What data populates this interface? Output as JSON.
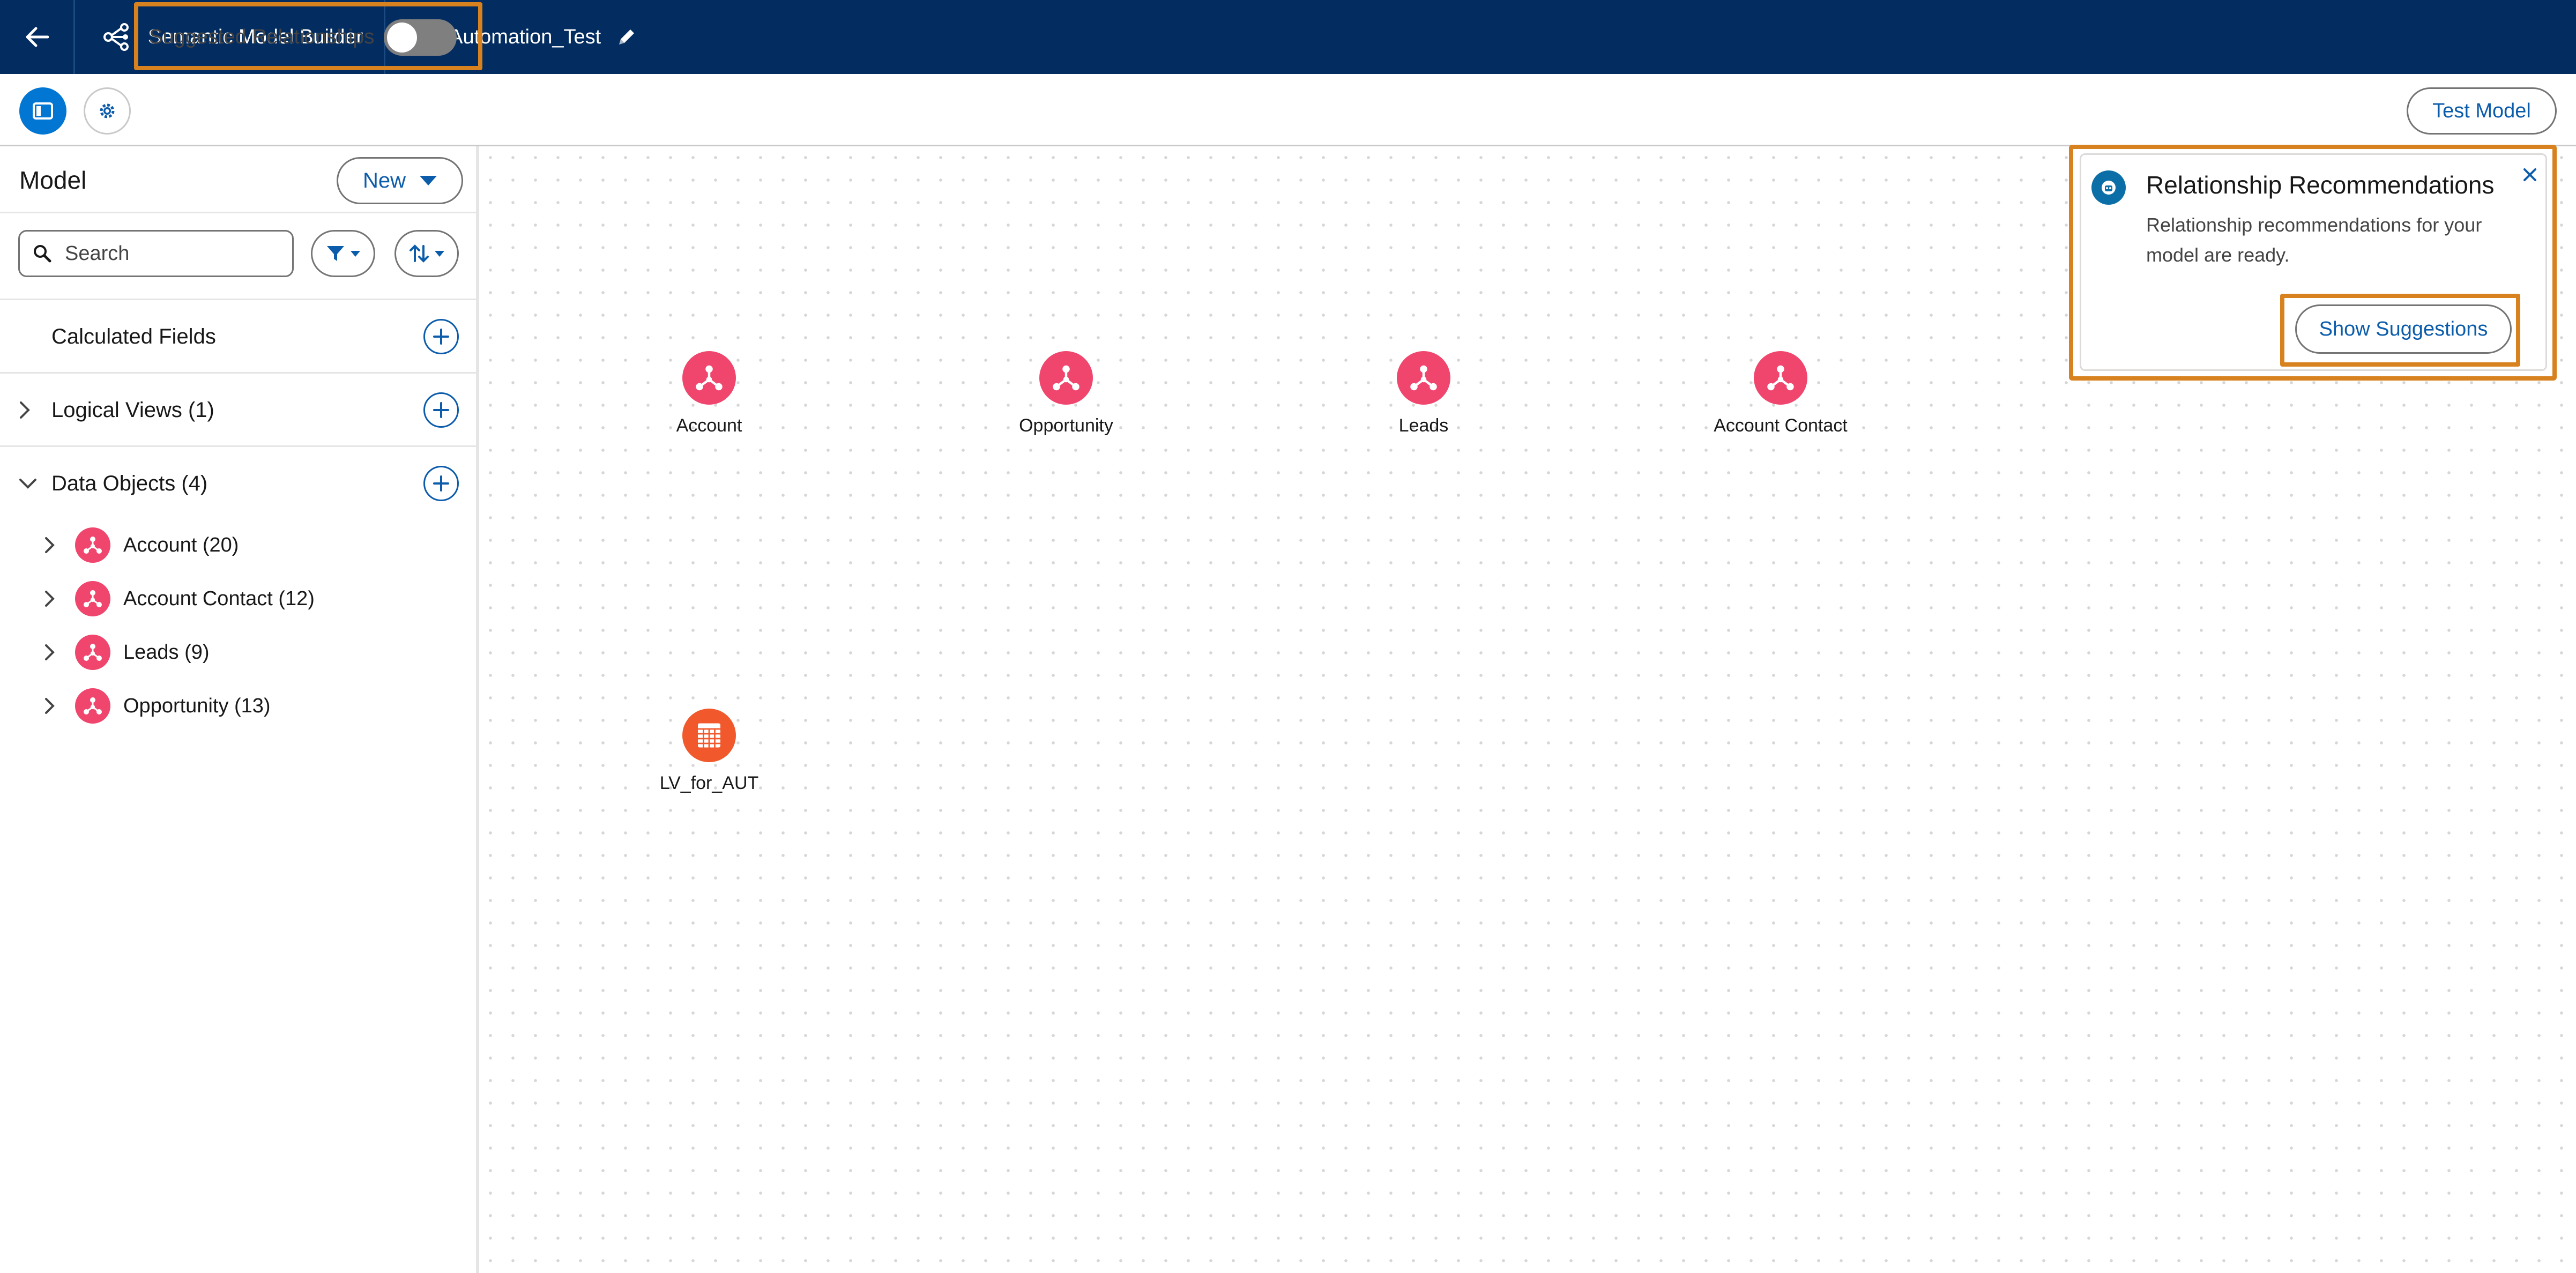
{
  "header": {
    "app_name": "Semantic Model Builder",
    "model_name": "SM_Automation_Test"
  },
  "toolbar": {
    "suggested_relationships_label": "Suggested Relationships",
    "suggested_relationships_on": false,
    "test_model_label": "Test Model"
  },
  "sidebar": {
    "title": "Model",
    "new_label": "New",
    "search_placeholder": "Search",
    "sections": [
      {
        "label": "Calculated Fields"
      },
      {
        "label": "Logical Views (1)"
      },
      {
        "label": "Data Objects (4)"
      }
    ],
    "data_objects": [
      {
        "label": "Account (20)"
      },
      {
        "label": "Account Contact (12)"
      },
      {
        "label": "Leads (9)"
      },
      {
        "label": "Opportunity (13)"
      }
    ]
  },
  "canvas": {
    "nodes": [
      {
        "label": "Account",
        "icon": "data-object-icon"
      },
      {
        "label": "Opportunity",
        "icon": "data-object-icon"
      },
      {
        "label": "Leads",
        "icon": "data-object-icon"
      },
      {
        "label": "Account Contact",
        "icon": "data-object-icon"
      },
      {
        "label": "LV_for_AUT",
        "icon": "logical-view-icon"
      }
    ]
  },
  "popover": {
    "title": "Relationship Recommendations",
    "body": "Relationship recommendations for your model are ready.",
    "button_label": "Show Suggestions"
  },
  "colors": {
    "header_bg": "#032d60",
    "brand_blue": "#0176d3",
    "link_blue": "#0b5cab",
    "data_object_pink": "#f0466e",
    "logical_view_orange": "#f1582c",
    "highlight_orange": "#d7821f"
  }
}
